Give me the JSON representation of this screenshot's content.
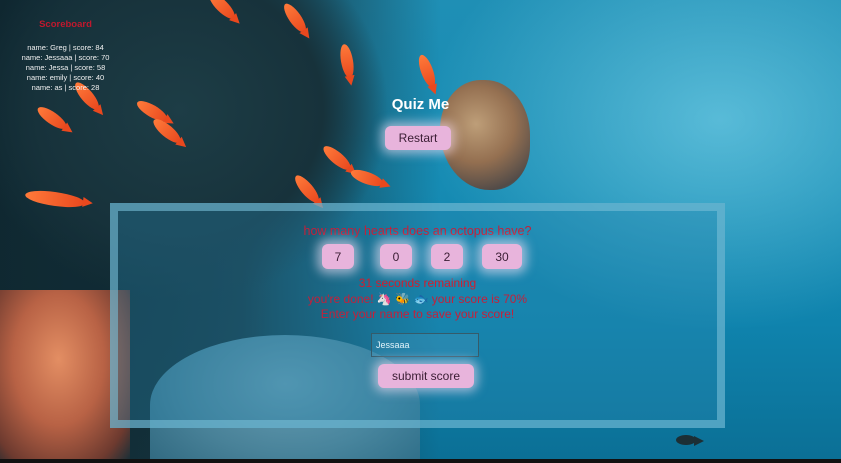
{
  "scoreboard": {
    "title": "Scoreboard",
    "entries": [
      "name: Greg | score: 84",
      "name: Jessaaa | score: 70",
      "name: Jessa | score: 58",
      "name: emily | score: 40",
      "name: as | score: 28"
    ]
  },
  "header": {
    "title": "Quiz Me",
    "restart_label": "Restart"
  },
  "quiz": {
    "question": "how many hearts does an octopus have?",
    "answers": [
      "7",
      "0",
      "2",
      "30"
    ],
    "timer_text": "31 seconds remaining",
    "result_text": "you're done! 🦄 🐝 🐟 your score is 70%",
    "prompt_text": "Enter your name to save your score!",
    "name_input_value": "Jessaaa",
    "name_input_placeholder": "Jessaaa",
    "submit_label": "submit score"
  },
  "colors": {
    "accent_button": "#e8b4dc",
    "question_text": "#c4203a",
    "scoreboard_title": "#c0182d"
  }
}
